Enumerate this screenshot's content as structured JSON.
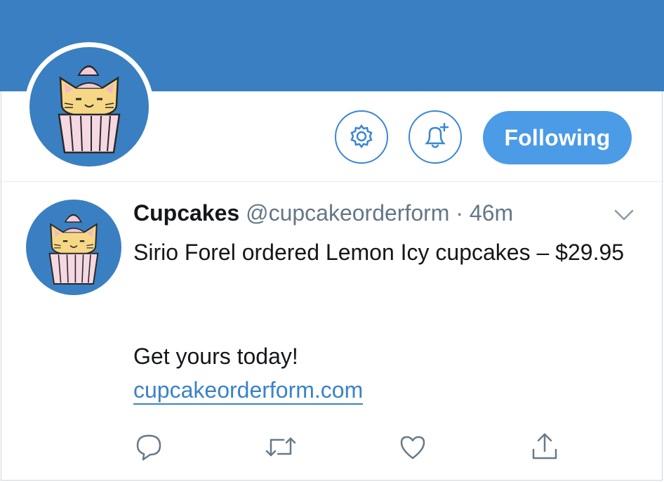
{
  "profile": {
    "banner_color": "#3a7fc1",
    "avatar_icon": "cat-cupcake-icon",
    "actions": {
      "settings_icon": "gear-icon",
      "notify_icon": "bell-plus-icon",
      "following_label": "Following"
    }
  },
  "tweet": {
    "avatar_icon": "cat-cupcake-icon",
    "author_name": "Cupcakes",
    "author_handle": "@cupcakeorderform",
    "separator": "·",
    "time": "46m",
    "menu_icon": "chevron-down-icon",
    "text_line": "Sirio Forel ordered Lemon Icy cupcakes – $29.95",
    "cta": "Get yours today!",
    "link": "cupcakeorderform.com",
    "actions": [
      {
        "name": "reply",
        "icon": "reply-icon"
      },
      {
        "name": "retweet",
        "icon": "retweet-icon"
      },
      {
        "name": "like",
        "icon": "heart-icon"
      },
      {
        "name": "share",
        "icon": "share-icon"
      }
    ]
  },
  "colors": {
    "accent": "#4b9be6",
    "link": "#3a82c8",
    "muted": "#657786",
    "icon": "#667a8a"
  }
}
